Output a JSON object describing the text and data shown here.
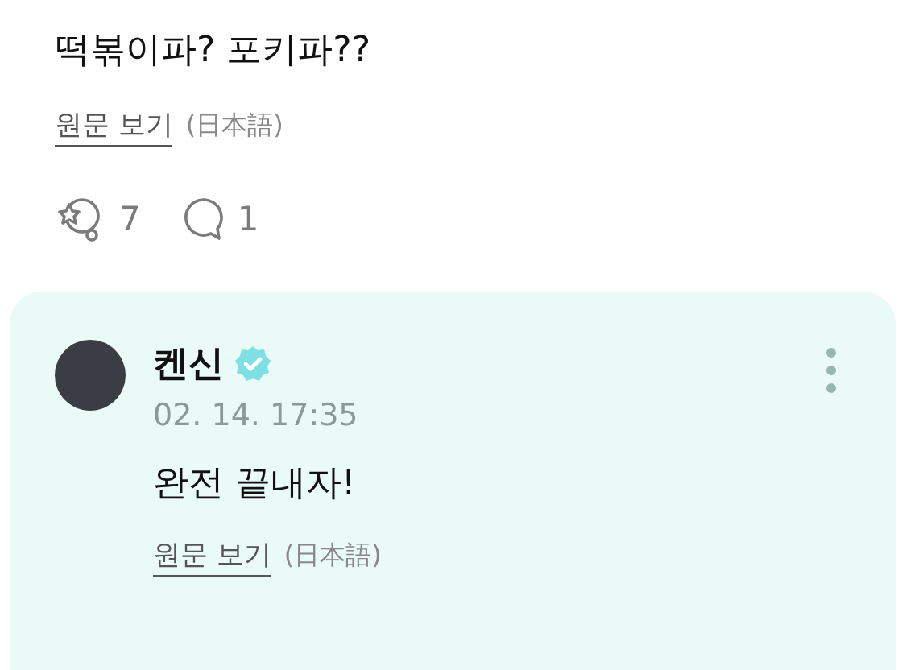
{
  "post": {
    "text": "떡볶이파? 포키파??",
    "translate_link": "원문 보기",
    "language": "(日本語)",
    "reactions": "7",
    "comments": "1"
  },
  "reply": {
    "author": "켄신",
    "verified": true,
    "date": "02. 14. 17:35",
    "text": "완전 끝내자!",
    "translate_link": "원문 보기",
    "language": "(日本語)"
  }
}
